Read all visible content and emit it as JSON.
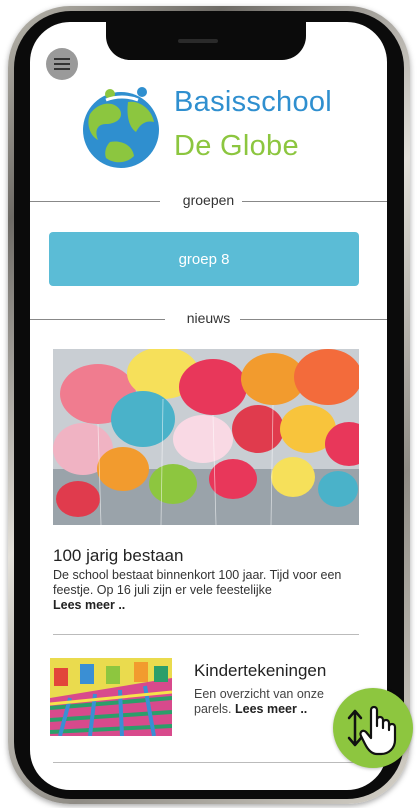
{
  "header": {
    "menu_icon": "hamburger-icon",
    "logo_icon": "globe-logo-icon",
    "brand_line1": "Basisschool",
    "brand_line2": "De Globe"
  },
  "colors": {
    "brand_blue": "#2f8fcf",
    "brand_green": "#8cc63f",
    "button_blue": "#5bbcd6",
    "scroll_green": "#8dc63f"
  },
  "sections": {
    "groups_label": "groepen",
    "news_label": "nieuws"
  },
  "groups": [
    {
      "label": "groep 8"
    }
  ],
  "news": [
    {
      "image": "balloons-photo",
      "title": "100 jarig bestaan",
      "text": "De school bestaat binnenkort 100 jaar. Tijd voor een feestje. Op 16 juli zijn er vele feestelijke",
      "more": "Lees meer .."
    },
    {
      "image": "children-drawing-thumbnail",
      "title": "Kindertekeningen",
      "text": "Een overzicht van onze parels.",
      "more": "Lees meer .."
    }
  ],
  "overlay": {
    "scroll_icon": "scroll-gesture-icon"
  }
}
